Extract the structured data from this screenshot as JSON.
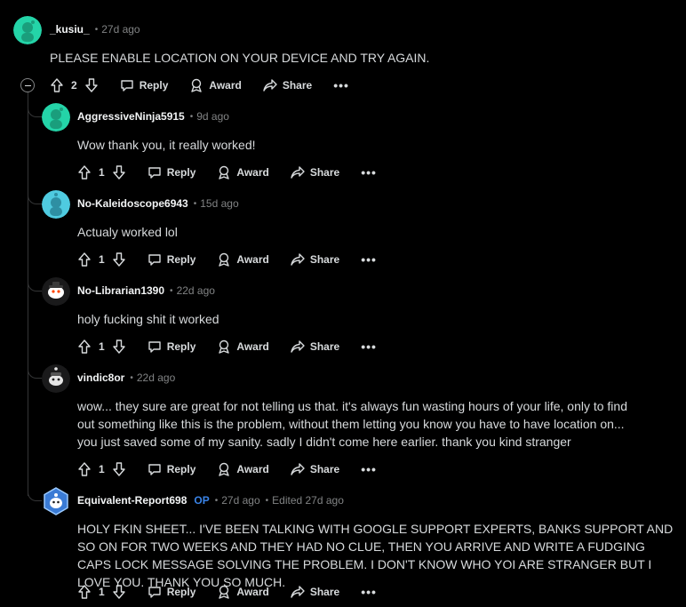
{
  "actions": {
    "reply": "Reply",
    "award": "Award",
    "share": "Share",
    "more": "•••"
  },
  "comments": [
    {
      "author": "_kusiu_",
      "time": "27d ago",
      "body": "PLEASE ENABLE LOCATION ON YOUR DEVICE AND TRY AGAIN.",
      "votes": "2",
      "avatar_color": "#24d4a8"
    },
    {
      "author": "AggressiveNinja5915",
      "time": "9d ago",
      "body": "Wow thank you, it really worked!",
      "votes": "1",
      "avatar_color": "#24d4a8"
    },
    {
      "author": "No-Kaleidoscope6943",
      "time": "15d ago",
      "body": "Actualy worked lol",
      "votes": "1",
      "avatar_color": "#4fcbe0"
    },
    {
      "author": "No-Librarian1390",
      "time": "22d ago",
      "body": "holy fucking shit it worked",
      "votes": "1",
      "avatar_color": "#e8e8e8"
    },
    {
      "author": "vindic8or",
      "time": "22d ago",
      "body": "wow... they sure are great for not telling us that. it's always fun wasting hours of your life, only to find out something like this is the problem, without them letting you know you have to have location on... you just saved some of my sanity. sadly I didn't come here earlier. thank you kind stranger",
      "votes": "1",
      "avatar_color": "#2a2a2a"
    },
    {
      "author": "Equivalent-Report698",
      "op": "OP",
      "time": "27d ago",
      "edited": "Edited 27d ago",
      "body": "HOLY FKIN SHEET... I'VE BEEN TALKING WITH GOOGLE SUPPORT EXPERTS, BANKS SUPPORT AND SO ON FOR TWO WEEKS AND THEY HAD NO CLUE, THEN YOU ARRIVE AND WRITE A FUDGING CAPS LOCK MESSAGE SOLVING THE PROBLEM. I DON'T KNOW WHO YOI ARE STRANGER BUT I LOVE YOU. THANK YOU SO MUCH.",
      "votes": "1",
      "avatar_color": "#3a7bd5"
    }
  ]
}
